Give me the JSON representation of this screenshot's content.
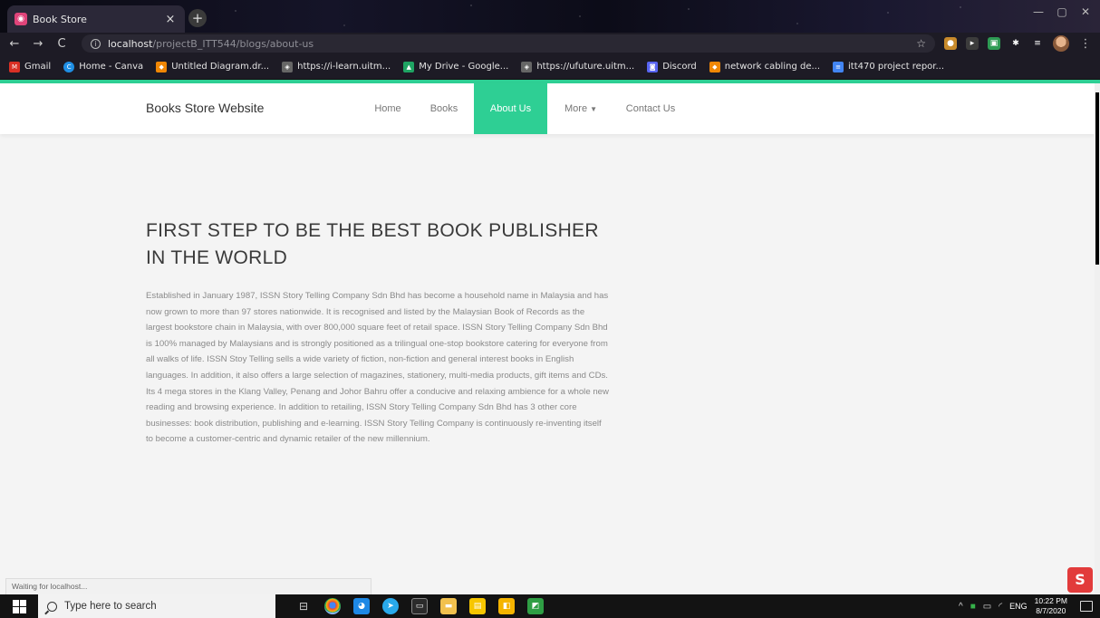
{
  "browser": {
    "tab_title": "Book Store",
    "tab_close": "×",
    "new_tab": "+",
    "url_host": "localhost",
    "url_path": "/projectB_ITT544/blogs/about-us",
    "nav": {
      "back": "←",
      "forward": "→",
      "reload": "C"
    },
    "bookmarks": [
      {
        "label": "Gmail",
        "icon": "gmail-icon",
        "color": "#d93025"
      },
      {
        "label": "Home - Canva",
        "icon": "canva-icon",
        "color": "#1f8fe5"
      },
      {
        "label": "Untitled Diagram.dr...",
        "icon": "drawio-icon",
        "color": "#f08705"
      },
      {
        "label": "https://i-learn.uitm...",
        "icon": "uitm-icon",
        "color": "#666666"
      },
      {
        "label": "My Drive - Google...",
        "icon": "drive-icon",
        "color": "#1fa463"
      },
      {
        "label": "https://ufuture.uitm...",
        "icon": "uitm-icon",
        "color": "#666666"
      },
      {
        "label": "Discord",
        "icon": "discord-icon",
        "color": "#5865f2"
      },
      {
        "label": "network cabling de...",
        "icon": "drawio-icon",
        "color": "#f08705"
      },
      {
        "label": "itt470 project repor...",
        "icon": "docs-icon",
        "color": "#4285f4"
      }
    ]
  },
  "site": {
    "brand": "Books Store Website",
    "nav": {
      "home": "Home",
      "books": "Books",
      "about": "About Us",
      "more": "More",
      "contact": "Contact Us"
    },
    "accent_color": "#2ecf94",
    "headline": "FIRST STEP TO BE THE BEST BOOK PUBLISHER IN THE WORLD",
    "body": "Established in January 1987, ISSN Story Telling Company Sdn Bhd has become a household name in Malaysia and has now grown to more than 97 stores nationwide. It is recognised and listed by the Malaysian Book of Records as the largest bookstore chain in Malaysia, with over 800,000 square feet of retail space. ISSN Story Telling Company Sdn Bhd is 100% managed by Malaysians and is strongly positioned as a trilingual one-stop bookstore catering for everyone from all walks of life. ISSN Stoy Telling sells a wide variety of fiction, non-fiction and general interest books in English languages. In addition, it also offers a large selection of magazines, stationery, multi-media products, gift items and CDs. Its 4 mega stores in the Klang Valley, Penang and Johor Bahru offer a conducive and relaxing ambience for a whole new reading and browsing experience. In addition to retailing, ISSN Story Telling Company Sdn Bhd has 3 other core businesses: book distribution, publishing and e-learning. ISSN Story Telling Company is continuously re-inventing itself to become a customer-centric and dynamic retailer of the new millennium."
  },
  "status_bar": "Waiting for localhost...",
  "taskbar": {
    "search_placeholder": "Type here to search",
    "language": "ENG",
    "time": "10:22 PM",
    "date": "8/7/2020"
  }
}
